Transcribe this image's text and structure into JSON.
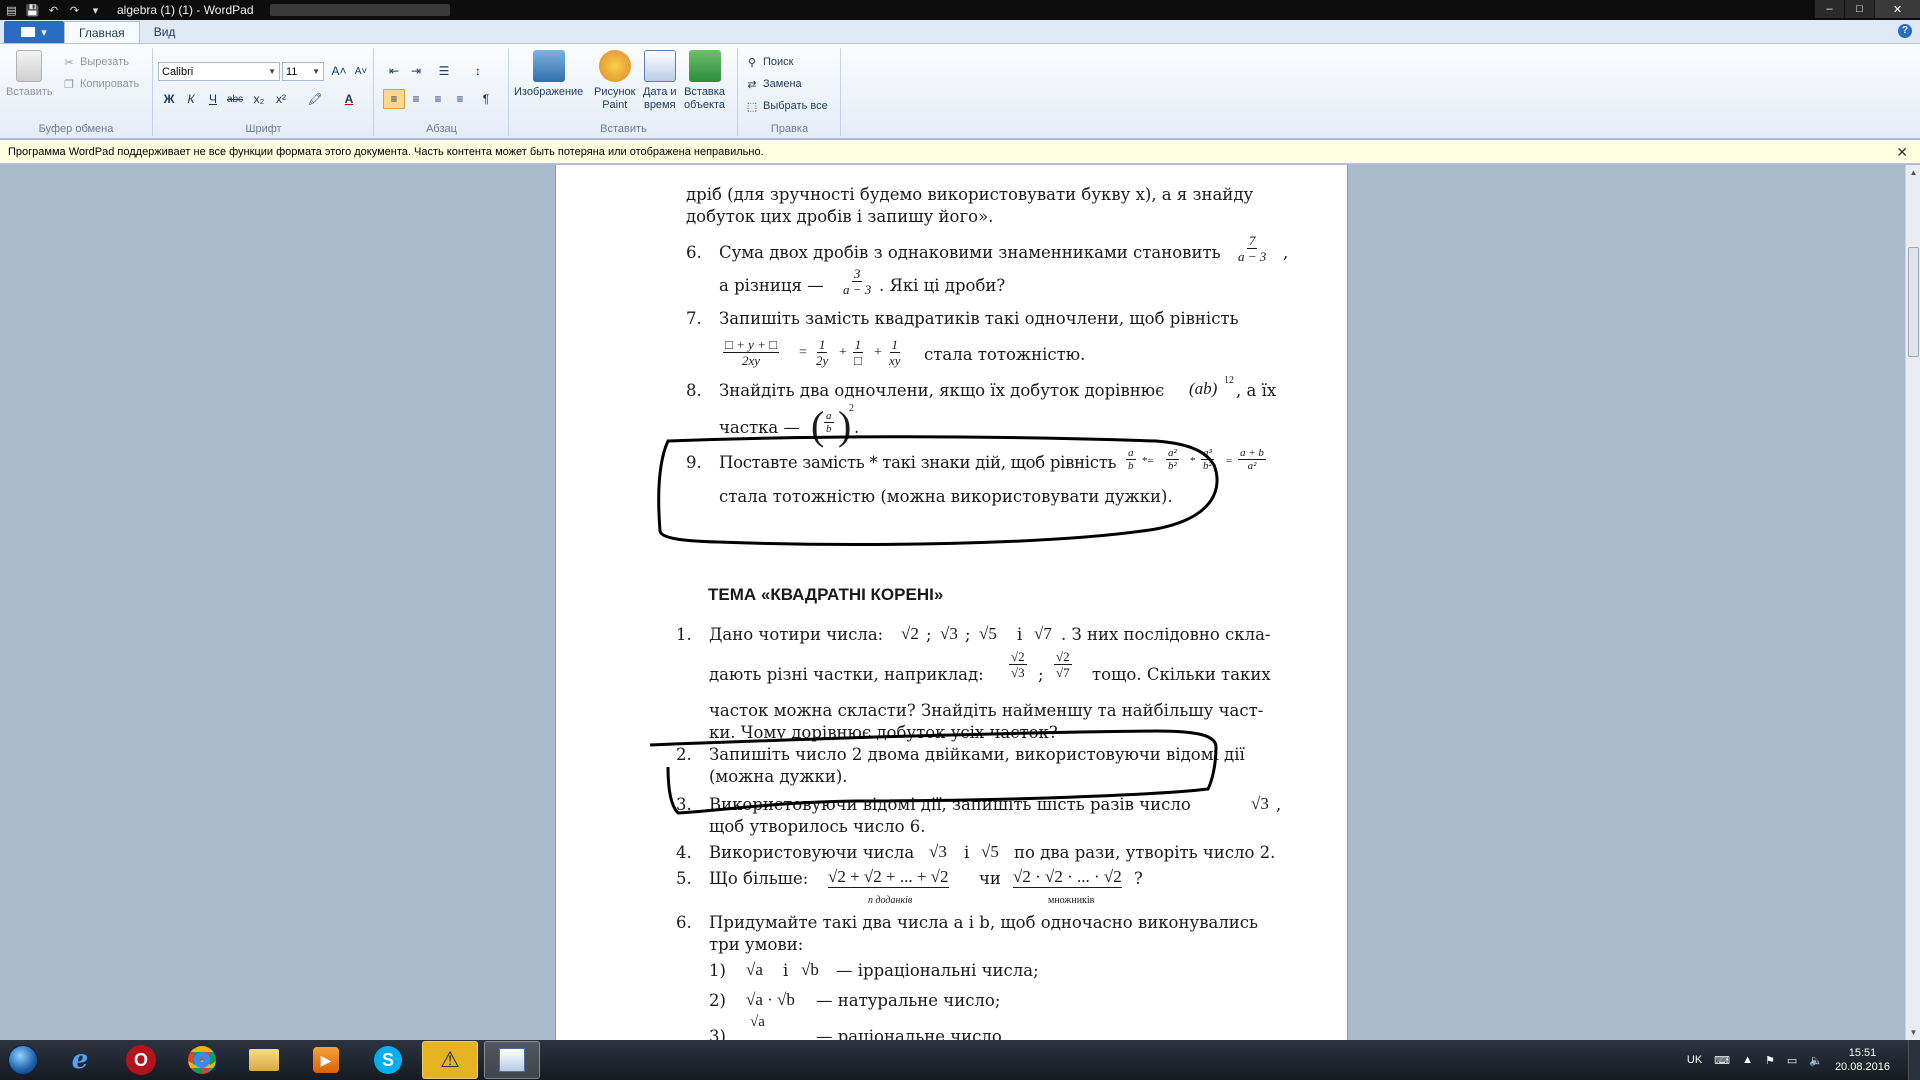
{
  "window": {
    "title": "algebra (1) (1) - WordPad",
    "controls": {
      "minimize": "–",
      "maximize": "□",
      "close": "✕"
    }
  },
  "quick_access": {
    "save_icon": "floppy-icon",
    "undo_icon": "undo-icon",
    "redo_icon": "redo-icon"
  },
  "tabs": [
    {
      "label": "Главная",
      "active": true
    },
    {
      "label": "Вид",
      "active": false
    }
  ],
  "ribbon": {
    "clipboard": {
      "label": "Буфер обмена",
      "paste": "Вставить",
      "cut": "Вырезать",
      "copy": "Копировать"
    },
    "font": {
      "label": "Шрифт",
      "family": "Calibri",
      "size": "11",
      "bold": "Ж",
      "italic": "К",
      "underline": "Ч",
      "strike": "abc",
      "sub": "x₂",
      "sup": "x²"
    },
    "paragraph": {
      "label": "Абзац"
    },
    "insert": {
      "label": "Вставить",
      "image": "Изображение",
      "paint": "Рисунок\nPaint",
      "datetime": "Дата и\nвремя",
      "object": "Вставка\nобъекта"
    },
    "editing": {
      "label": "Правка",
      "find": "Поиск",
      "replace": "Замена",
      "select_all": "Выбрать все"
    }
  },
  "infobar": {
    "message": "Программа WordPad поддерживает не все функции формата этого документа. Часть контента может быть потеряна или отображена неправильно."
  },
  "document": {
    "lines": {
      "l1": "дріб (для зручності будемо використовувати букву x), а я знайду",
      "l2": "добуток цих дробів і запишу його».",
      "n6": "6.",
      "p6a": "Сума двох дробів з однаковими знаменниками становить",
      "p6b": "а різниця —",
      "p6c": ". Які ці дроби?",
      "n7": "7.",
      "p7a": "Запишіть замість квадратиків такі одночлени, щоб рівність",
      "p7b": "стала тотожністю.",
      "n8": "8.",
      "p8a": "Знайдіть два одночлени, якщо їх добуток дорівнює",
      "p8b": ", а їх",
      "p8c": "частка —",
      "n9": "9.",
      "p9a": "Поставте замість * такі знаки дій, щоб рівність",
      "p9b": "стала тотожністю (можна використовувати дужки).",
      "heading": "ТЕМА «КВАДРАТНІ КОРЕНІ»",
      "k1": "1.",
      "k1a": "Дано чотири числа:",
      "k1a2": ". З них послідовно скла-",
      "k1b": "дають різні частки, наприклад:",
      "k1b2": "тощо. Скільки таких",
      "k1c": "часток можна скласти? Знайдіть найменшу та найбільшу част-",
      "k1d": "ки. Чому дорівнює добуток усіх часток?",
      "k2": "2.",
      "k2a": "Запишіть число 2 двома двійками, використовуючи відомі дії",
      "k2b": "(можна дужки).",
      "k3": "3.",
      "k3a": "Використовуючи відомі дії, запишіть шість разів число",
      "k3b": "щоб утворилось число 6.",
      "k4": "4.",
      "k4a": "Використовуючи числа",
      "k4b": "по два рази, утворіть число 2.",
      "k5": "5.",
      "k5a": "Що більше:",
      "k5b": "чи",
      "k5c": "?",
      "k6": "6.",
      "k6a": "Придумайте такі два числа a і b, щоб одночасно виконувались",
      "k6b": "три умови:",
      "s1": "1)",
      "s1a": "— ірраціональні числа;",
      "s2": "2)",
      "s2a": "— натуральне число;",
      "s3": "3)",
      "s3a": "— раціональне число"
    },
    "math": {
      "f6a_num": "7",
      "f6a_den": "a − 3",
      "f6b_num": "3",
      "f6b_den": "a − 3",
      "f7_lhs_num": "□ + y + □",
      "f7_lhs_den": "2xy",
      "f7_t1_num": "1",
      "f7_t1_den": "2y",
      "f7_t2_num": "1",
      "f7_t2_den": "□",
      "f7_t3_num": "1",
      "f7_t3_den": "xy",
      "m8": "(ab)",
      "m8exp": "12",
      "f8_num": "a",
      "f8_den": "b",
      "f8exp": "2",
      "f9_1n": "a",
      "f9_1d": "b",
      "f9_2n": "a²",
      "f9_2d": "b²",
      "f9_3n": "a³",
      "f9_3d": "b²",
      "f9_4n": "a + b",
      "f9_4d": "a²",
      "r2": "√2",
      "r3": "√3",
      "r5": "√5",
      "r7": "√7",
      "sep": ";",
      "and": "і",
      "q1n": "√2",
      "q1d": "√3",
      "q2n": "√2",
      "q2d": "√7",
      "sum": "√2 + √2 + ... + √2",
      "sum_under": "n доданків",
      "prod": "√2 · √2 · ... · √2",
      "prod_under": "множників",
      "ra": "√a",
      "rb": "√b",
      "rab": "√a · √b",
      "ra_frac": "√a"
    }
  },
  "taskbar": {
    "apps": [
      "ie-icon",
      "opera-icon",
      "chrome-icon",
      "explorer-icon",
      "media-icon",
      "skype-icon",
      "warning-icon",
      "wordpad-icon"
    ],
    "lang": "UK",
    "time": "15:51",
    "date": "20.08.2016"
  }
}
